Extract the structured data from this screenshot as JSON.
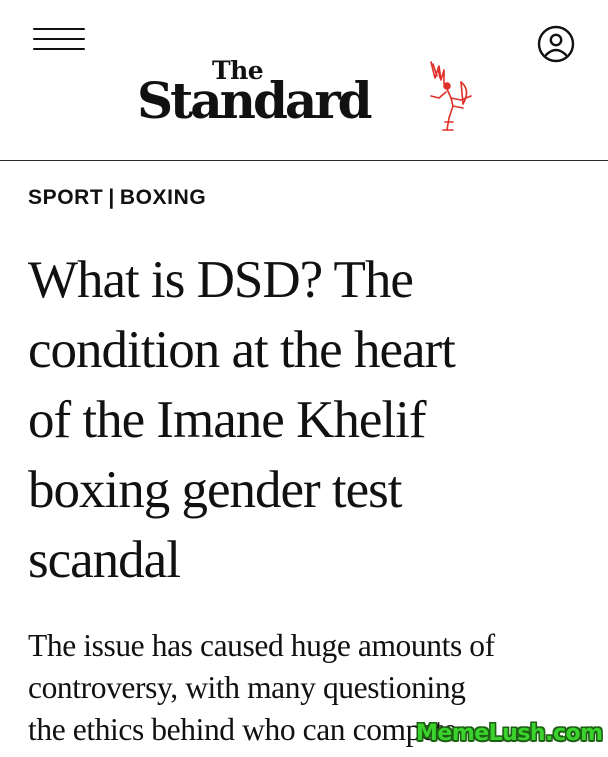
{
  "header": {
    "menu_icon": "hamburger-menu-icon",
    "account_icon": "user-account-icon",
    "logo": {
      "the": "The",
      "name": "Standard",
      "emblem_icon": "eros-statue-icon",
      "emblem_color": "#e0302b"
    }
  },
  "article": {
    "category": {
      "section": "SPORT",
      "separator": "|",
      "subsection": "BOXING"
    },
    "headline_lines": [
      "What is DSD? The",
      "condition at the heart",
      "of the Imane Khelif",
      "boxing gender test",
      "scandal"
    ],
    "standfirst_lines": [
      "The issue has caused huge amounts of",
      "controversy, with many questioning",
      "the ethics behind who can compete"
    ]
  },
  "watermark": {
    "text": "MemeLush.com",
    "color": "#3bd22e"
  }
}
